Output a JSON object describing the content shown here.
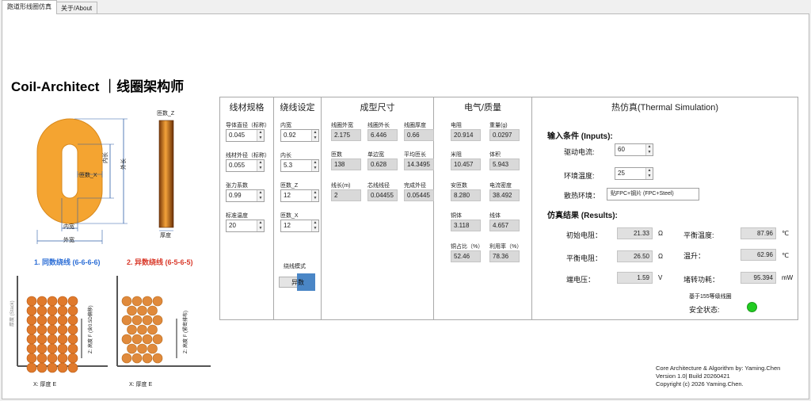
{
  "tabs": [
    {
      "label": "跑道形线圈仿真",
      "active": true
    },
    {
      "label": "关于/About",
      "active": false
    }
  ],
  "app_title": "Coil-Architect ｜线圈架构师",
  "diagram": {
    "labels": {
      "turns_x": "匝数_X",
      "inner_len": "内长",
      "outer_len": "外长",
      "inner_width": "内宽",
      "outer_width": "外宽",
      "turns_z": "匝数_Z",
      "thickness": "厚度"
    },
    "mode1_caption": "1. 同数绕线 (6-6-6-6)",
    "mode2_caption": "2. 异数绕线 (6-5-6-5)",
    "mode1_color": "#2e6fd6",
    "mode2_color": "#d93a2b",
    "coil_color": "#f4a431",
    "side_y_label": "厚度 (Stack)",
    "z_axis_label1": "Z: 高度 F (含0.5D偏移)",
    "z_axis_label2": "Z: 高度 F (紧密排布)",
    "x_axis_label1": "X: 厚度 E",
    "x_axis_label2": "X: 厚度 E"
  },
  "wire_spec": {
    "header": "线材规格",
    "fields": [
      {
        "label": "导体直径（标称）",
        "value": "0.045"
      },
      {
        "label": "线材外径（标称）",
        "value": "0.055"
      },
      {
        "label": "张力系数",
        "value": "0.99"
      },
      {
        "label": "标准温度",
        "value": "20"
      }
    ]
  },
  "winding": {
    "header": "绕线设定",
    "fields": [
      {
        "label": "内宽",
        "value": "0.92"
      },
      {
        "label": "内长",
        "value": "5.3"
      },
      {
        "label": "匝数_Z",
        "value": "12"
      },
      {
        "label": "匝数_X",
        "value": "12"
      }
    ],
    "mode_label": "绕线模式",
    "mode_value": "异数"
  },
  "formed_size": {
    "header": "成型尺寸",
    "fields": [
      {
        "label": "线圈外宽",
        "value": "2.175"
      },
      {
        "label": "线圈外长",
        "value": "6.446"
      },
      {
        "label": "线圈厚度",
        "value": "0.66"
      },
      {
        "label": "匝数",
        "value": "138"
      },
      {
        "label": "单边宽",
        "value": "0.628"
      },
      {
        "label": "平均匝长",
        "value": "14.3495"
      },
      {
        "label": "线长(m)",
        "value": "2"
      },
      {
        "label": "芯线线径",
        "value": "0.04455"
      },
      {
        "label": "完成外径",
        "value": "0.05445"
      }
    ]
  },
  "electrical": {
    "header": "电气/质量",
    "fields": [
      {
        "label": "电阻",
        "value": "20.914"
      },
      {
        "label": "重量(g)",
        "value": "0.0297"
      },
      {
        "label": "米阻",
        "value": "10.457"
      },
      {
        "label": "体积",
        "value": "5.943"
      },
      {
        "label": "安匝数",
        "value": "8.280"
      },
      {
        "label": "电流密度",
        "value": "38.492"
      },
      {
        "label": "铜体",
        "value": "3.118"
      },
      {
        "label": "线体",
        "value": "4.657"
      },
      {
        "label": "铜占比（%）",
        "value": "52.46"
      },
      {
        "label": "利用率（%）",
        "value": "78.36"
      }
    ]
  },
  "thermal": {
    "header": "热仿真(Thermal Simulation)",
    "inputs_title": "输入条件 (Inputs):",
    "current_label": "驱动电流:",
    "current_value": "60",
    "ambient_label": "环境温度:",
    "ambient_value": "25",
    "env_label": "散热环境：",
    "env_value": "贴FPC+钢片 (FPC+Steel)",
    "results_title": "仿真结果 (Results):",
    "results": [
      {
        "label": "初始电阻：",
        "value": "21.33",
        "unit": "Ω"
      },
      {
        "label": "平衡温度:",
        "value": "87.96",
        "unit": "℃"
      },
      {
        "label": "平衡电阻：",
        "value": "26.50",
        "unit": "Ω"
      },
      {
        "label": "温升：",
        "value": "62.96",
        "unit": "℃"
      },
      {
        "label": "端电压：",
        "value": "1.59",
        "unit": "V"
      },
      {
        "label": "堵转功耗：",
        "value": "95.394",
        "unit": "mW"
      }
    ],
    "basis_note": "基于155等级线圈",
    "safety_label": "安全状态:",
    "safety_color": "#22cc22"
  },
  "footer": {
    "line1": "Core Architecture & Algorithm by: Yaming.Chen",
    "line2": "Version  1.0| Build 20260421",
    "line3": "Copyright (c) 2026 Yaming.Chen."
  }
}
